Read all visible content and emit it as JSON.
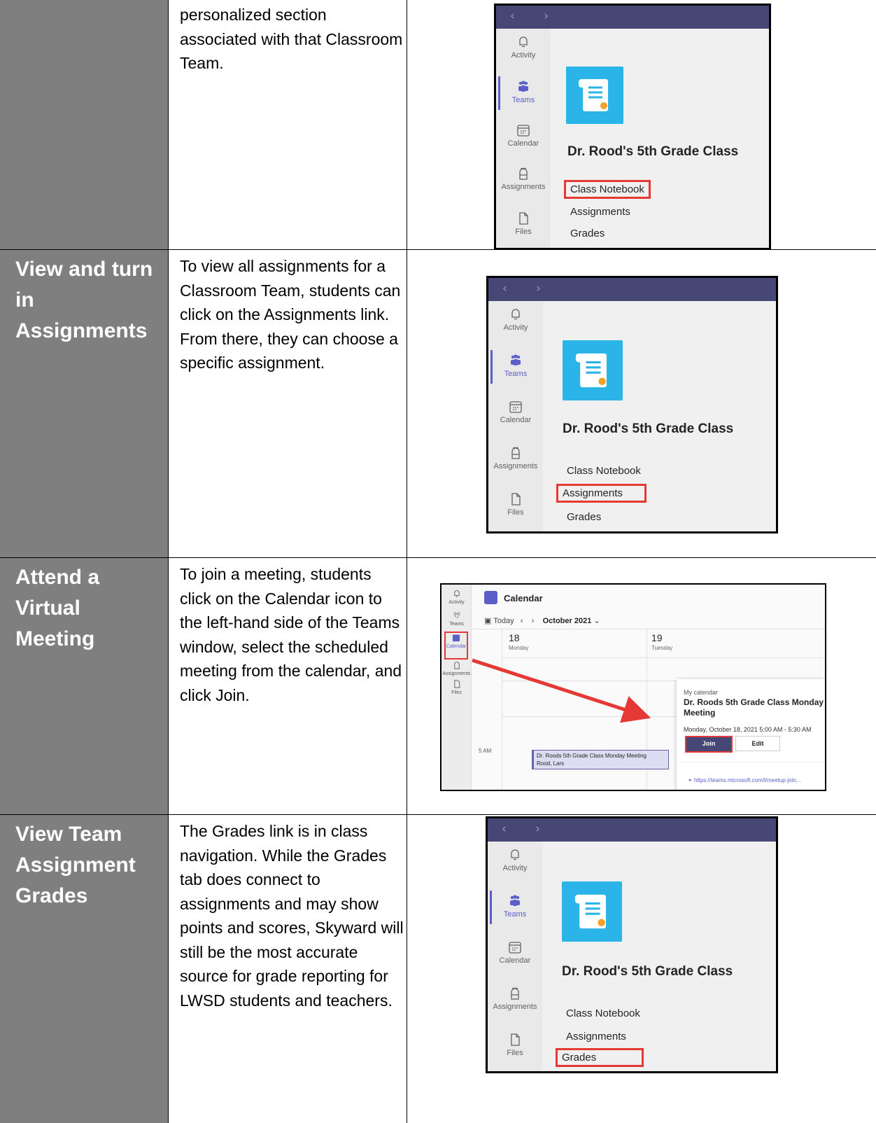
{
  "rows": [
    {
      "heading": "",
      "description": "personalized section associated with that Classroom Team.",
      "screenshot": {
        "class_name": "Dr. Rood's 5th Grade Class",
        "rail": [
          "Activity",
          "Teams",
          "Calendar",
          "Assignments",
          "Files"
        ],
        "links": [
          "Class Notebook",
          "Assignments",
          "Grades"
        ],
        "highlighted_link": "Class Notebook"
      }
    },
    {
      "heading": "View and turn in Assignments",
      "description": "To view all assignments for a Classroom Team, students can click on the Assignments link. From there, they can choose a specific assignment.",
      "screenshot": {
        "class_name": "Dr. Rood's 5th Grade Class",
        "rail": [
          "Activity",
          "Teams",
          "Calendar",
          "Assignments",
          "Files"
        ],
        "links": [
          "Class Notebook",
          "Assignments",
          "Grades"
        ],
        "highlighted_link": "Assignments"
      }
    },
    {
      "heading": "Attend a Virtual Meeting",
      "description": "To join a meeting, students click on the Calendar icon to the left-hand side of the Teams window, select the scheduled meeting from the calendar, and click Join.",
      "screenshot": {
        "rail": [
          "Activity",
          "Teams",
          "Calendar",
          "Assignments",
          "Files"
        ],
        "title": "Calendar",
        "today": "Today",
        "month": "October 2021",
        "days": [
          {
            "date": "18",
            "name": "Monday"
          },
          {
            "date": "19",
            "name": "Tuesday"
          }
        ],
        "time_label": "5 AM",
        "event_title": "Dr. Roods 5th Grade Class Monday Meeting",
        "event_organizer": "Rood, Lars",
        "popup": {
          "calendar": "My calendar",
          "title": "Dr. Roods 5th Grade Class Monday Meeting",
          "time": "Monday, October 18, 2021 5:00 AM - 5:30 AM",
          "join": "Join",
          "edit": "Edit",
          "link": "https://teams.microsoft.com/l/meetup-join..."
        }
      }
    },
    {
      "heading": "View Team Assignment Grades",
      "description": "The Grades link is in class navigation. While the Grades tab does connect to assignments and may show points and scores, Skyward will still be the most accurate source for grade reporting for LWSD students and teachers.",
      "screenshot": {
        "class_name": "Dr. Rood's 5th Grade Class",
        "rail": [
          "Activity",
          "Teams",
          "Calendar",
          "Assignments",
          "Files"
        ],
        "links": [
          "Class Notebook",
          "Assignments",
          "Grades"
        ],
        "highlighted_link": "Grades"
      }
    }
  ],
  "colors": {
    "heading_bg": "#7f7f7f",
    "teams_purple": "#464775",
    "accent": "#5b5fc7",
    "highlight": "#e53935",
    "class_tile": "#2ab4e8"
  }
}
